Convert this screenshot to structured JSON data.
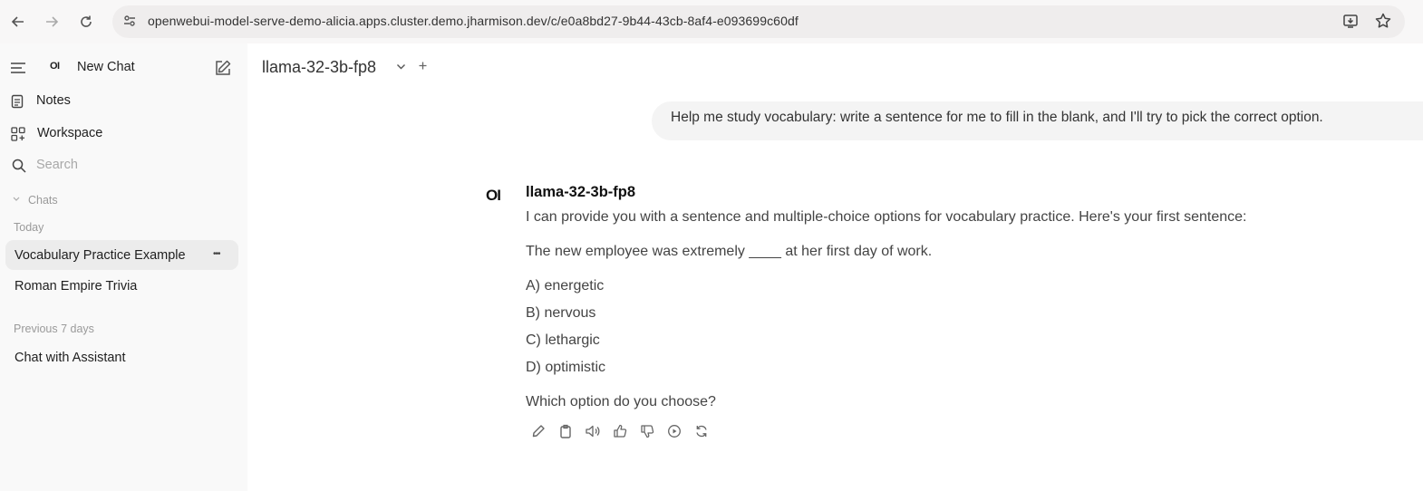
{
  "browser": {
    "url": "openwebui-model-serve-demo-alicia.apps.cluster.demo.jharmison.dev/c/e0a8bd27-9b44-43cb-8af4-e093699c60df"
  },
  "sidebar": {
    "logo": "OI",
    "new_chat": "New Chat",
    "notes": "Notes",
    "workspace": "Workspace",
    "search_placeholder": "Search",
    "chats_header": "Chats",
    "groups": [
      {
        "label": "Today",
        "items": [
          "Vocabulary Practice Example",
          "Roman Empire Trivia"
        ]
      },
      {
        "label": "Previous 7 days",
        "items": [
          "Chat with Assistant"
        ]
      }
    ],
    "more_label": "•••"
  },
  "main": {
    "model_name": "llama-32-3b-fp8",
    "user_message": "Help me study vocabulary: write a sentence for me to fill in the blank, and I'll try to pick the correct option.",
    "assistant": {
      "logo": "OI",
      "name": "llama-32-3b-fp8",
      "lines": [
        "I can provide you with a sentence and multiple-choice options for vocabulary practice. Here's your first sentence:",
        "The new employee was extremely ____ at her first day of work.",
        "A) energetic",
        "B) nervous",
        "C) lethargic",
        "D) optimistic",
        "Which option do you choose?"
      ]
    }
  }
}
